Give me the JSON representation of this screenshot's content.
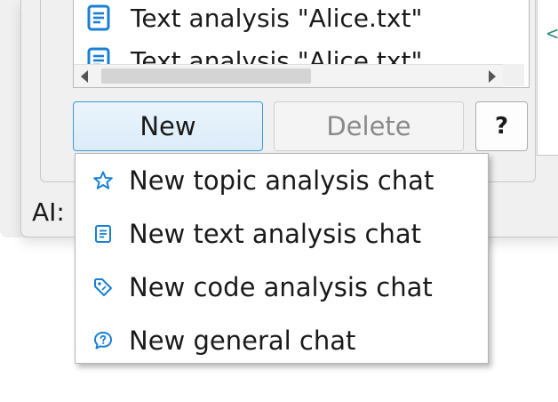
{
  "colors": {
    "accent": "#1a7fd4",
    "button_border_active": "#3c9ad8",
    "disabled_text": "#8a8a8a"
  },
  "list": {
    "items": [
      {
        "label": "Text analysis \"Alice.txt\"",
        "icon": "document-icon"
      },
      {
        "label": "Text analysis \"Alice.txt\"",
        "icon": "document-icon"
      }
    ]
  },
  "buttons": {
    "new_label": "New",
    "delete_label": "Delete",
    "help_label": "?"
  },
  "ai_label": "AI:",
  "right_pane_glyph": "<",
  "menu": {
    "items": [
      {
        "label": "New topic analysis chat",
        "icon": "star-icon"
      },
      {
        "label": "New text analysis chat",
        "icon": "document-icon"
      },
      {
        "label": "New code analysis chat",
        "icon": "tag-icon"
      },
      {
        "label": "New general chat",
        "icon": "help-chat-icon"
      }
    ]
  }
}
